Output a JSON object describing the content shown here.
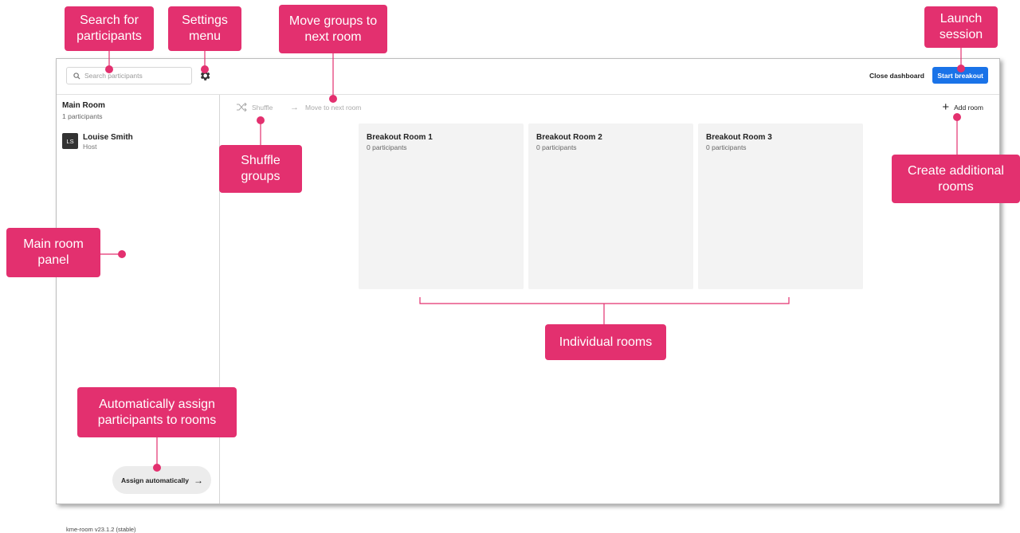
{
  "topbar": {
    "search_placeholder": "Search participants",
    "close_dashboard_label": "Close dashboard",
    "start_breakout_label": "Start breakout"
  },
  "sidebar": {
    "title": "Main Room",
    "participant_count": "1 participants",
    "participants": [
      {
        "initials": "LS",
        "name": "Louise Smith",
        "role": "Host"
      }
    ],
    "assign_label": "Assign automatically",
    "version": "kme-room v23.1.2 (stable)"
  },
  "toolbar": {
    "shuffle_label": "Shuffle",
    "move_label": "Move to next room",
    "add_room_label": "Add room"
  },
  "rooms": [
    {
      "title": "Breakout Room 1",
      "count": "0 participants"
    },
    {
      "title": "Breakout Room 2",
      "count": "0 participants"
    },
    {
      "title": "Breakout Room 3",
      "count": "0 participants"
    }
  ],
  "annotations": {
    "search": "Search for participants",
    "settings": "Settings menu",
    "move": "Move groups to next room",
    "launch": "Launch session",
    "shuffle": "Shuffle groups",
    "create_rooms": "Create additional rooms",
    "main_panel": "Main room panel",
    "individual_rooms": "Individual rooms",
    "assign": "Automatically assign participants to rooms"
  },
  "colors": {
    "accent": "#e3306f",
    "primary_button": "#1a73e8"
  }
}
